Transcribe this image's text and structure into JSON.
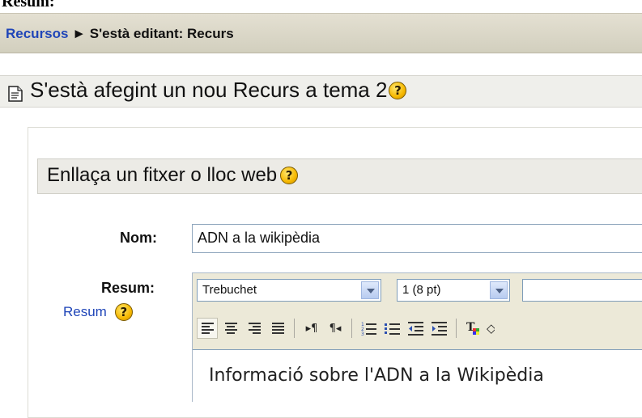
{
  "top_label": "Resum:",
  "breadcrumb": {
    "link": "Recursos",
    "separator": "►",
    "current": "S'està editant: Recurs"
  },
  "main_heading": "S'està afegint un nou Recurs a tema 2",
  "section_heading": "Enllaça un fitxer o lloc web",
  "form": {
    "name_label": "Nom:",
    "name_value": "ADN a la wikipèdia",
    "summary_label": "Resum:",
    "summary_help_link": "Resum"
  },
  "editor": {
    "font_select": "Trebuchet",
    "size_select": "1 (8 pt)",
    "third_select": "",
    "content_text": "Informació sobre l'ADN a la Wikipèdia"
  },
  "icons": {
    "help": "help-icon",
    "document": "document-icon"
  },
  "colors": {
    "link": "#1f45b8",
    "navbar": "#d8d5c6",
    "help_icon": "#f6b800"
  }
}
